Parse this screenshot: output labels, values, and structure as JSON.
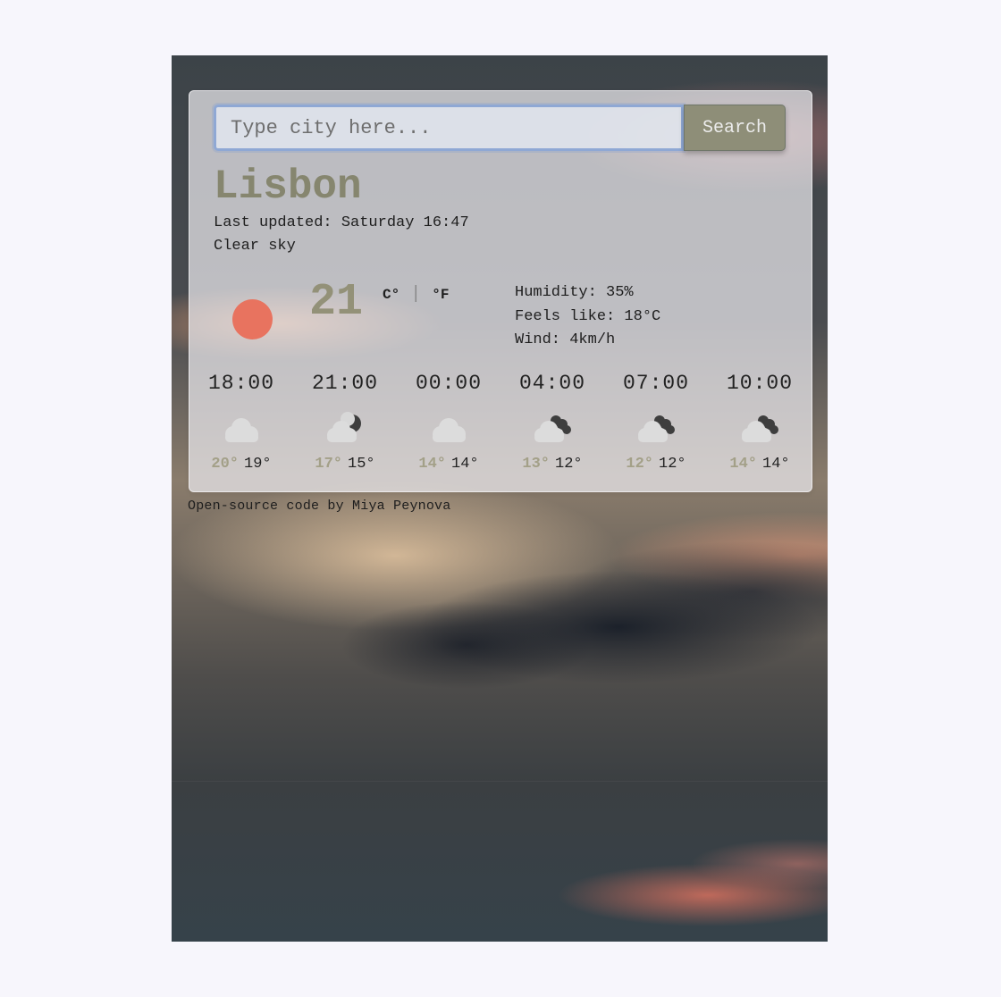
{
  "search": {
    "placeholder": "Type city here...",
    "button_label": "Search"
  },
  "current": {
    "city": "Lisbon",
    "last_updated": "Last updated: Saturday 16:47",
    "conditions": "Clear sky",
    "temperature": "21",
    "unit_celsius": "C°",
    "unit_separator": "|",
    "unit_fahrenheit": "°F",
    "icon": "sun-icon",
    "humidity": "Humidity: 35%",
    "feels_like": "Feels like: 18°C",
    "wind": "Wind: 4km/h"
  },
  "forecast": [
    {
      "time": "18:00",
      "icon": "cloud-icon",
      "max": "20°",
      "min": "19°"
    },
    {
      "time": "21:00",
      "icon": "cloud-moon-icon",
      "max": "17°",
      "min": "15°"
    },
    {
      "time": "00:00",
      "icon": "cloud-icon",
      "max": "14°",
      "min": "14°"
    },
    {
      "time": "04:00",
      "icon": "broken-clouds-icon",
      "max": "13°",
      "min": "12°"
    },
    {
      "time": "07:00",
      "icon": "broken-clouds-icon",
      "max": "12°",
      "min": "12°"
    },
    {
      "time": "10:00",
      "icon": "broken-clouds-icon",
      "max": "14°",
      "min": "14°"
    }
  ],
  "footer": {
    "link_text": "Open-source code",
    "byline": " by Miya Peynova"
  },
  "colors": {
    "accent_olive": "#86866f",
    "sun": "#e8735f",
    "search_button": "#8e8e78",
    "input_focus": "#8fa8d4"
  }
}
